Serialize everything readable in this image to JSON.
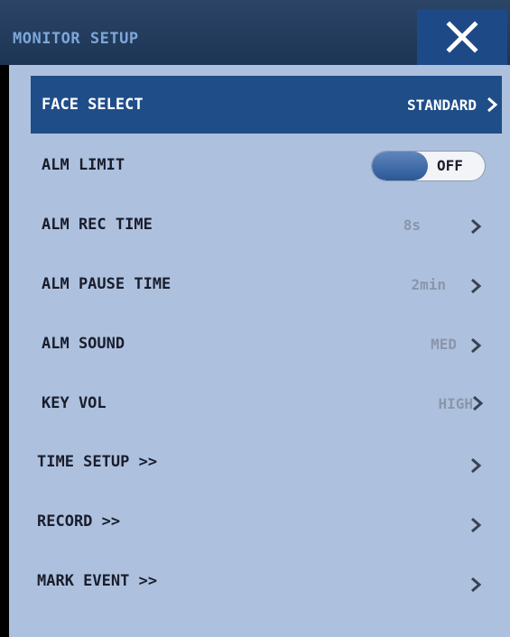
{
  "header": {
    "title": "MONITOR SETUP",
    "close_icon": "close-icon"
  },
  "colors": {
    "header_bg": "#1d3555",
    "panel_bg": "#adc1df",
    "selected_bg": "#1f4d88",
    "value_text": "#8a96a8"
  },
  "rows": {
    "face_select": {
      "label": "FACE SELECT",
      "value": "STANDARD"
    },
    "alm_limit": {
      "label": "ALM LIMIT",
      "toggle_state": "OFF"
    },
    "alm_rec_time": {
      "label": "ALM REC TIME",
      "value": "8s"
    },
    "alm_pause_time": {
      "label": "ALM PAUSE TIME",
      "value": "2min"
    },
    "alm_sound": {
      "label": "ALM SOUND",
      "value": "MED"
    },
    "key_vol": {
      "label": "KEY VOL",
      "value": "HIGH"
    },
    "time_setup": {
      "label": "TIME SETUP >>"
    },
    "record": {
      "label": "RECORD >>"
    },
    "mark_event": {
      "label": "MARK EVENT >>"
    }
  }
}
